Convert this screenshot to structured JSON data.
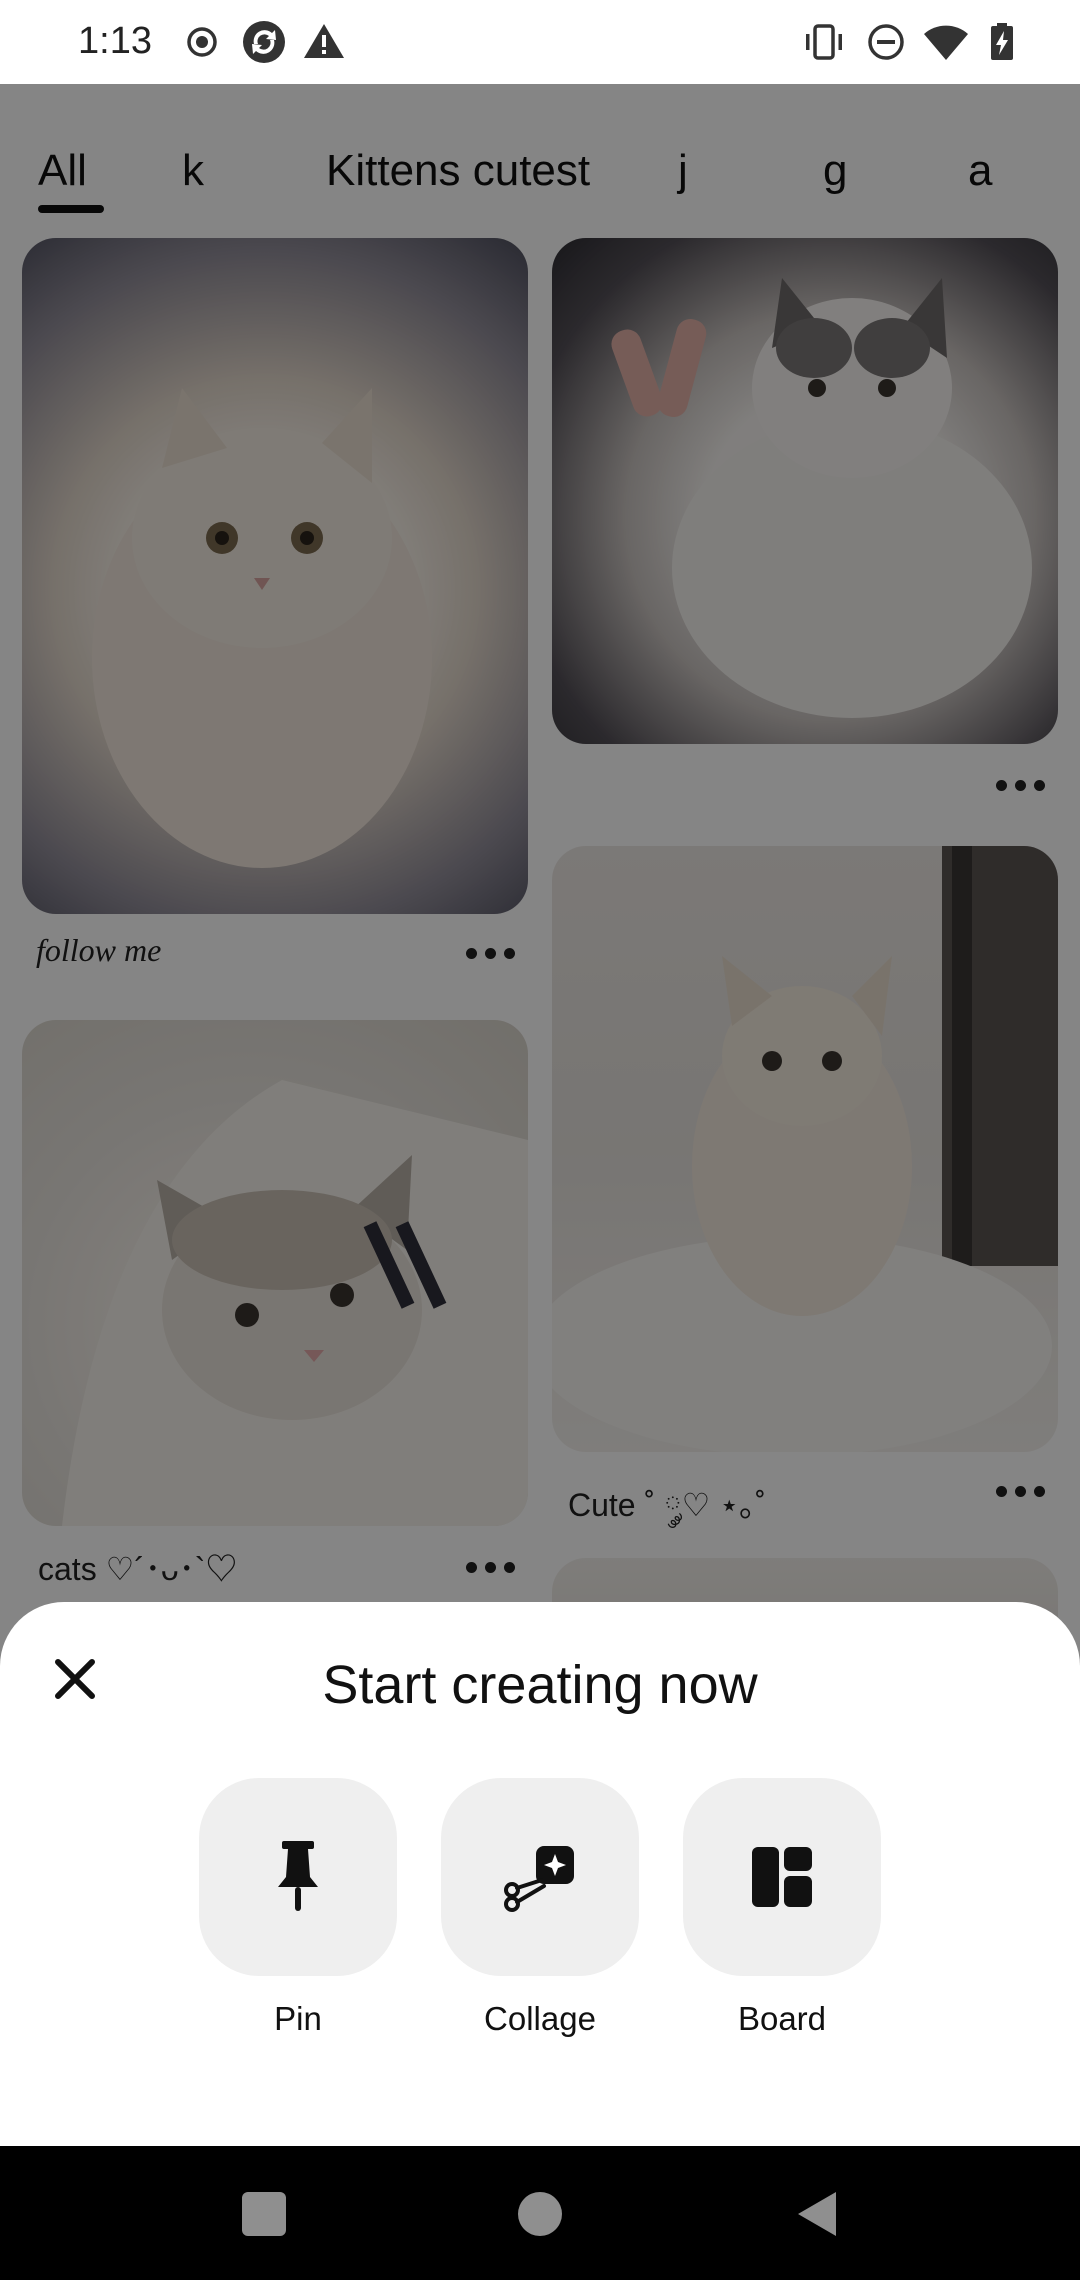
{
  "status_bar": {
    "time": "1:13",
    "left_icons": [
      "record-icon",
      "sync-app-icon",
      "warning-icon"
    ],
    "right_icons": [
      "vibrate-icon",
      "do-not-disturb-icon",
      "wifi-icon",
      "battery-charging-icon"
    ]
  },
  "tabs": [
    {
      "label": "All",
      "selected": true
    },
    {
      "label": "k"
    },
    {
      "label": "Kittens cutest"
    },
    {
      "label": "j"
    },
    {
      "label": "g"
    },
    {
      "label": "a"
    }
  ],
  "feed": {
    "pins": [
      {
        "caption": "follow me",
        "more_icon": "more-icon"
      },
      {
        "caption": "",
        "more_icon": "more-icon"
      },
      {
        "caption": "Cute ˚ ༘♡ ⋆｡˚",
        "more_icon": "more-icon"
      },
      {
        "caption": "cats ♡´･ᴗ･`♡",
        "more_icon": "more-icon"
      }
    ]
  },
  "sheet": {
    "title": "Start creating now",
    "close_icon": "close-icon",
    "actions": [
      {
        "label": "Pin",
        "icon": "pushpin-icon"
      },
      {
        "label": "Collage",
        "icon": "scissors-collage-icon"
      },
      {
        "label": "Board",
        "icon": "board-layout-icon"
      }
    ]
  },
  "nav_bar": {
    "icons": [
      "recents-square-icon",
      "home-circle-icon",
      "back-triangle-icon"
    ]
  },
  "colors": {
    "scrim": "#000000",
    "sheet_background": "#ffffff",
    "action_button": "#efefef",
    "nav_bar": "#000000"
  }
}
